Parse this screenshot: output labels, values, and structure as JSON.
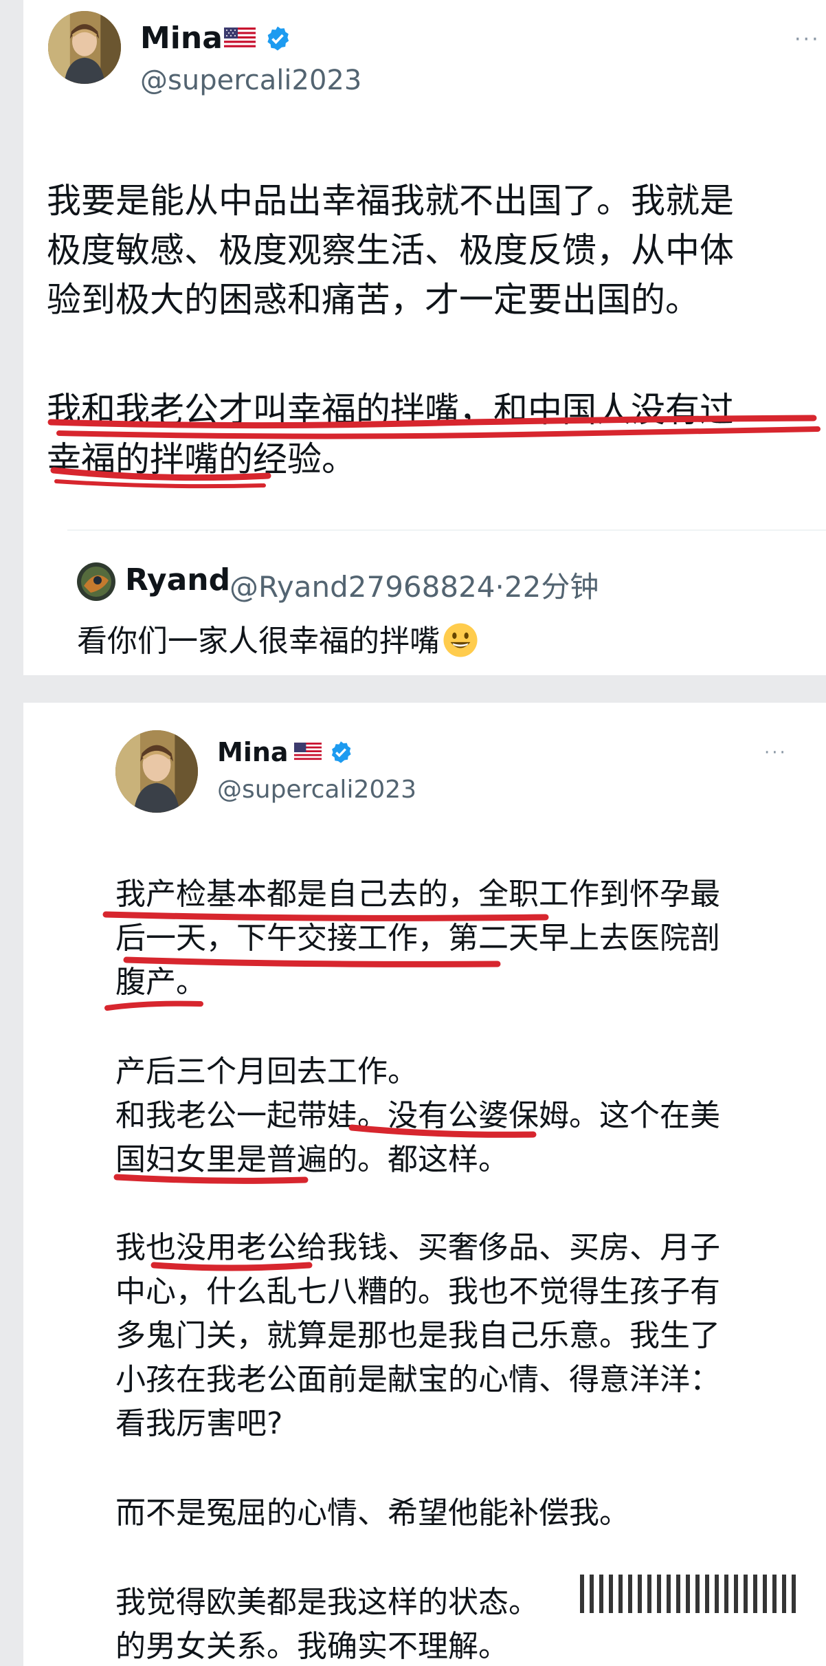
{
  "tweet1": {
    "name": "Mina",
    "handle": "@supercali2023",
    "more": "···",
    "paragraphs": [
      "我要是能从中品出幸福我就不出国了。我就是",
      "极度敏感、极度观察生活、极度反馈，从中体",
      "验到极大的困惑和痛苦，才一定要出国的。",
      "我和我老公才叫幸福的拌嘴，和中国人没有过",
      "幸福的拌嘴的经验。"
    ],
    "reply": {
      "name": "Ryand",
      "meta": "@Ryand27968824·22分钟",
      "text": "看你们一家人很幸福的拌嘴",
      "emoji": "grinning-face-emoji"
    }
  },
  "tweet2": {
    "name": "Mina",
    "handle": "@supercali2023",
    "more": "···",
    "lines": [
      "我产检基本都是自己去的，全职工作到怀孕最",
      "后一天，下午交接工作，第二天早上去医院剖",
      "腹产。",
      "产后三个月回去工作。",
      "和我老公一起带娃。没有公婆保姆。这个在美",
      "国妇女里是普遍的。都这样。",
      "我也没用老公给我钱、买奢侈品、买房、月子",
      "中心，什么乱七八糟的。我也不觉得生孩子有",
      "多鬼门关，就算是那也是我自己乐意。我生了",
      "小孩在我老公面前是献宝的心情、得意洋洋：",
      "看我厉害吧?",
      "而不是冤屈的心情、希望他能补偿我。",
      "我觉得欧美都是我这样的状态。",
      "的男女关系。我确实不理解。"
    ]
  },
  "colors": {
    "verified": "#1d9bf0",
    "underline": "#d7262e",
    "secondary_text": "#536471"
  }
}
